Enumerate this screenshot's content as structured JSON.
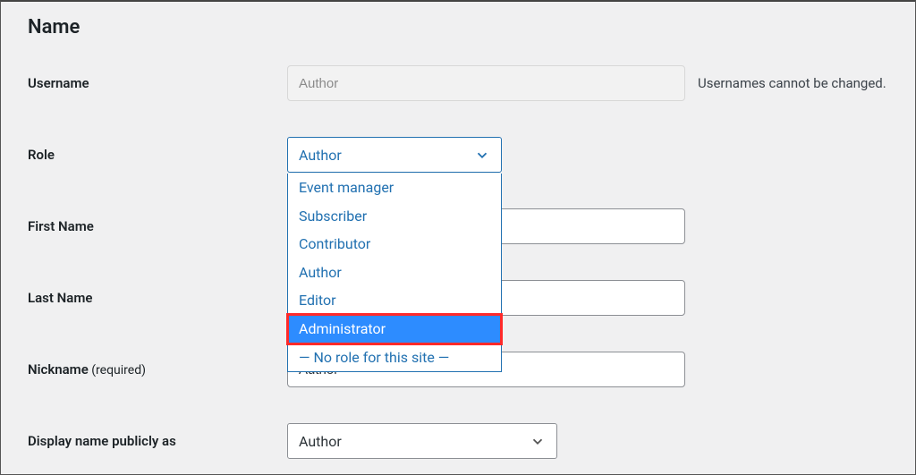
{
  "section_title": "Name",
  "rows": {
    "username": {
      "label": "Username",
      "value": "Author",
      "hint": "Usernames cannot be changed."
    },
    "role": {
      "label": "Role",
      "selected": "Author",
      "options": [
        "Event manager",
        "Subscriber",
        "Contributor",
        "Author",
        "Editor",
        "Administrator",
        "— No role for this site —"
      ],
      "highlighted_index": 5
    },
    "first_name": {
      "label": "First Name",
      "value": ""
    },
    "last_name": {
      "label": "Last Name",
      "value": ""
    },
    "nickname": {
      "label": "Nickname",
      "required_note": " (required)",
      "value": "Author"
    },
    "display_name": {
      "label": "Display name publicly as",
      "selected": "Author"
    }
  }
}
